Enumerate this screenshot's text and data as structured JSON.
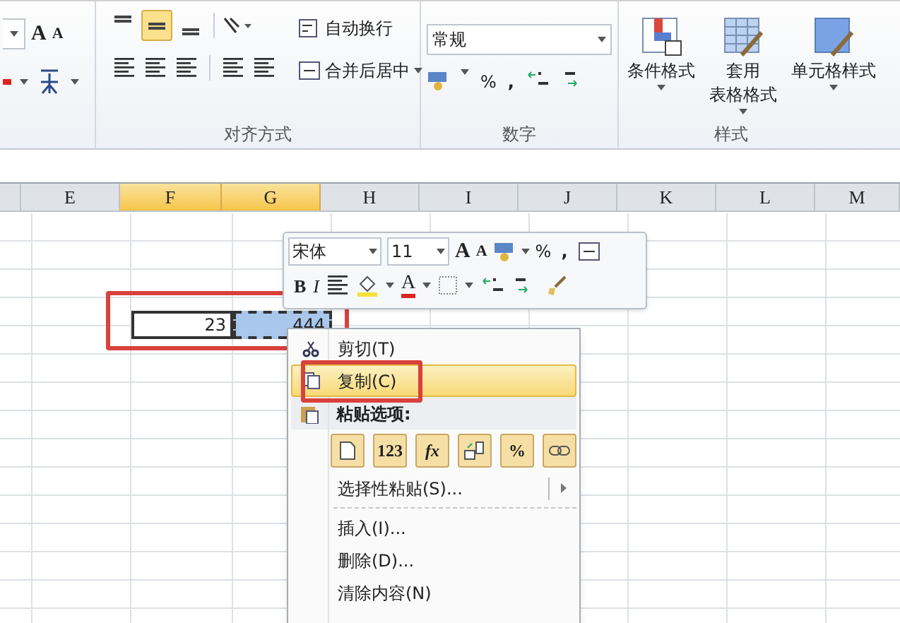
{
  "ribbon": {
    "font_group": {
      "grow_label": "A",
      "shrink_label": "A"
    },
    "alignment_group": {
      "label": "对齐方式",
      "align_buttons": [
        {
          "kind": "top",
          "selected": false
        },
        {
          "kind": "middle",
          "selected": true
        },
        {
          "kind": "bottom",
          "selected": false
        }
      ],
      "wrap_text": "自动换行",
      "merge_center": "合并后居中"
    },
    "number_group": {
      "label": "数字",
      "format": "常规",
      "percent": "%",
      "comma": ","
    },
    "styles_group": {
      "label": "样式",
      "buttons": [
        {
          "kind": "conditional",
          "lines": [
            "条件格式"
          ]
        },
        {
          "kind": "table",
          "lines": [
            "套用",
            "表格格式"
          ]
        },
        {
          "kind": "cell",
          "lines": [
            "单元格样式"
          ]
        }
      ]
    }
  },
  "columns": [
    {
      "label": "E",
      "selected": false
    },
    {
      "label": "F",
      "selected": true,
      "cell": "23"
    },
    {
      "label": "G",
      "selected": true,
      "cell": "444"
    },
    {
      "label": "H",
      "selected": false
    },
    {
      "label": "I",
      "selected": false
    },
    {
      "label": "J",
      "selected": false
    },
    {
      "label": "K",
      "selected": false
    },
    {
      "label": "L",
      "selected": false
    },
    {
      "label": "M",
      "selected": false
    }
  ],
  "mini_toolbar": {
    "font": "宋体",
    "size": "11",
    "grow_label": "A",
    "shrink_label": "A",
    "percent": "%",
    "comma": ",",
    "bold": "B",
    "italic": "I",
    "font_color_label": "A"
  },
  "context_menu": {
    "items": [
      {
        "kind": "item",
        "label": "剪切(T)",
        "selected": false
      },
      {
        "kind": "item",
        "label": "复制(C)",
        "selected": true
      },
      {
        "kind": "heading",
        "label": "粘贴选项:"
      },
      {
        "kind": "paste",
        "options": [
          {
            "kind": "page"
          },
          {
            "kind": "text",
            "label": "123"
          },
          {
            "kind": "formula",
            "label": "fx"
          },
          {
            "kind": "transpose"
          },
          {
            "kind": "percent",
            "label": "%"
          },
          {
            "kind": "link"
          }
        ]
      },
      {
        "kind": "submenu",
        "label": "选择性粘贴(S)...",
        "selected": false
      },
      {
        "kind": "separator"
      },
      {
        "kind": "item",
        "label": "插入(I)...",
        "selected": false
      },
      {
        "kind": "item",
        "label": "删除(D)...",
        "selected": false
      },
      {
        "kind": "item",
        "label": "清除内容(N)",
        "selected": false
      }
    ]
  }
}
